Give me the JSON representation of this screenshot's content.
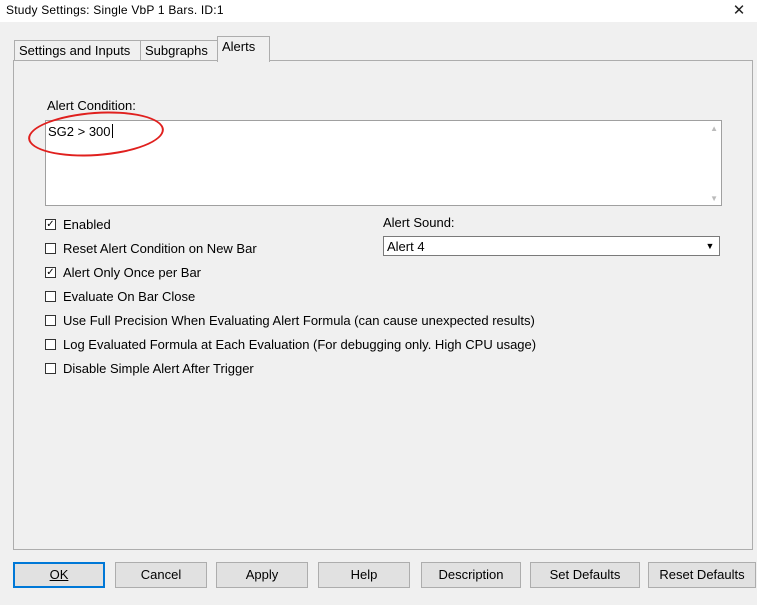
{
  "window": {
    "title": "Study Settings: Single VbP 1 Bars. ID:1",
    "close_icon": "close-icon"
  },
  "tabs": [
    {
      "label": "Settings and Inputs",
      "active": false
    },
    {
      "label": "Subgraphs",
      "active": false
    },
    {
      "label": "Alerts",
      "active": true
    }
  ],
  "alert": {
    "condition_label": "Alert Condition:",
    "condition_value": "SG2 > 300",
    "annotation_color": "#e0201e"
  },
  "options": [
    {
      "label": "Enabled",
      "checked": true
    },
    {
      "label": "Reset Alert Condition on New Bar",
      "checked": false
    },
    {
      "label": "Alert Only Once per Bar",
      "checked": true
    },
    {
      "label": "Evaluate On Bar Close",
      "checked": false
    },
    {
      "label": "Use Full Precision When Evaluating Alert Formula (can cause unexpected results)",
      "checked": false
    },
    {
      "label": "Log Evaluated Formula at Each Evaluation (For debugging only. High CPU usage)",
      "checked": false
    },
    {
      "label": "Disable Simple Alert After Trigger",
      "checked": false
    }
  ],
  "sound": {
    "label": "Alert Sound:",
    "value": "Alert 4"
  },
  "buttons": {
    "ok": "OK",
    "cancel": "Cancel",
    "apply": "Apply",
    "help": "Help",
    "description": "Description",
    "set_defaults": "Set Defaults",
    "reset_defaults": "Reset Defaults"
  }
}
